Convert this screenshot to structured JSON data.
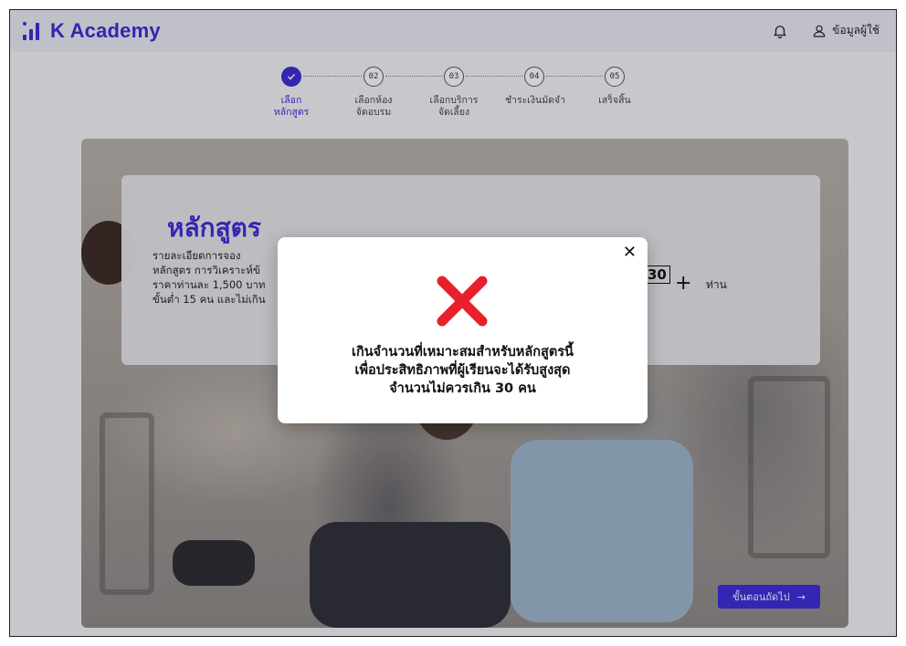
{
  "app": {
    "title": "K Academy"
  },
  "header": {
    "user_label": "ข้อมูลผู้ใช้"
  },
  "steps": [
    {
      "num": "01",
      "label_lines": [
        "เลือก",
        "หลักสูตร"
      ],
      "done": true
    },
    {
      "num": "02",
      "label_lines": [
        "เลือกห้อง",
        "จัดอบรม"
      ],
      "done": false
    },
    {
      "num": "03",
      "label_lines": [
        "เลือกบริการ",
        "จัดเลี้ยง"
      ],
      "done": false
    },
    {
      "num": "04",
      "label_lines": [
        "ชำระเงินมัดจำ",
        ""
      ],
      "done": false
    },
    {
      "num": "05",
      "label_lines": [
        "เสร็จสิ้น",
        ""
      ],
      "done": false
    }
  ],
  "course_card": {
    "title": "หลักสูตร",
    "details": [
      "รายละเอียดการจอง",
      "หลักสูตร การวิเคราะห์ข้",
      "ราคาท่านละ 1,500 บาท",
      "ขั้นต่ำ 15 คน และไม่เกิน"
    ],
    "quantity": "30",
    "plus": "+",
    "unit": "ท่าน"
  },
  "next_button": {
    "label": "ขั้นตอนถัดไป",
    "arrow": "→"
  },
  "modal": {
    "close_icon": "✕",
    "lines": [
      "เกินจำนวนที่เหมาะสมสำหรับหลักสูตรนี้",
      "เพื่อประสิทธิภาพที่ผู้เรียนจะได้รับสูงสุด",
      "จำนวนไม่ควรเกิน 30 คน"
    ]
  },
  "colors": {
    "brand": "#3a2bd8",
    "error": "#e8202c"
  }
}
